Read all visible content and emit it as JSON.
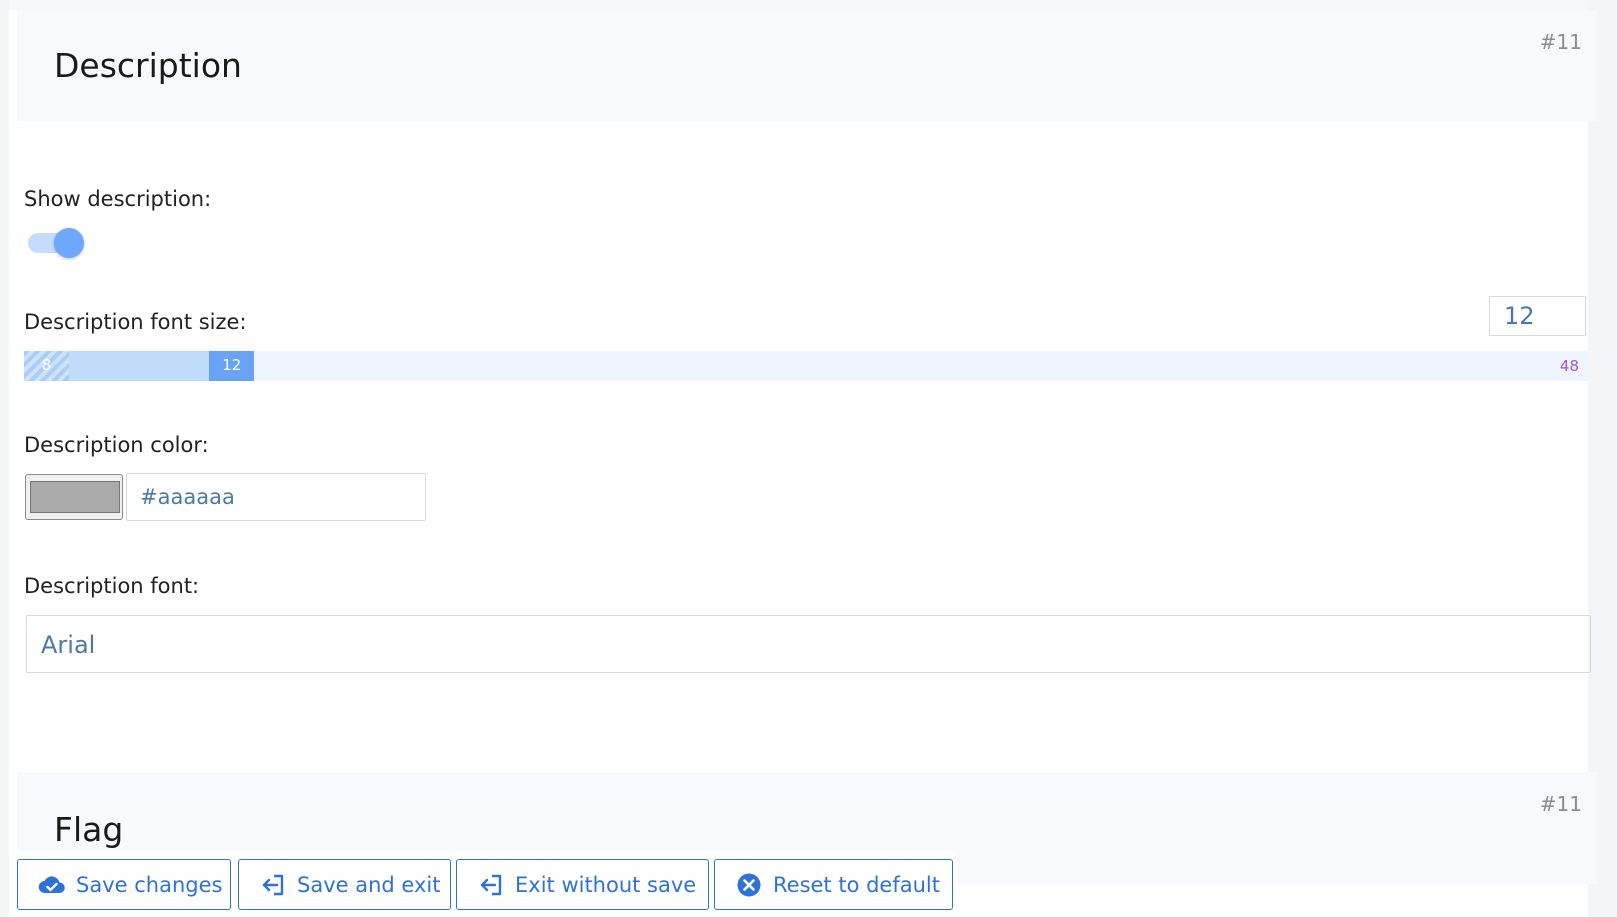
{
  "sections": [
    {
      "title": "Description",
      "number": "#11"
    },
    {
      "title": "Flag",
      "number": "#11"
    }
  ],
  "show_description": {
    "label": "Show description:",
    "enabled": true
  },
  "font_size": {
    "label": "Description font size:",
    "value": "12",
    "min": "8",
    "max": "48",
    "current": 12
  },
  "color": {
    "label": "Description color:",
    "value": "#aaaaaa",
    "swatch": "#aaaaaa"
  },
  "font": {
    "label": "Description font:",
    "value": "Arial"
  },
  "buttons": {
    "save_changes": {
      "label": "Save changes",
      "icon": "cloud-check-icon"
    },
    "save_exit": {
      "label": "Save and exit",
      "icon": "exit-arrow-icon"
    },
    "exit_no_save": {
      "label": "Exit without save",
      "icon": "exit-arrow-icon"
    },
    "reset": {
      "label": "Reset to default",
      "icon": "x-circle-icon"
    }
  },
  "colors": {
    "accent": "#2f72d6",
    "slider_thumb": "#68a3f5",
    "max_label": "#9b59d0"
  }
}
